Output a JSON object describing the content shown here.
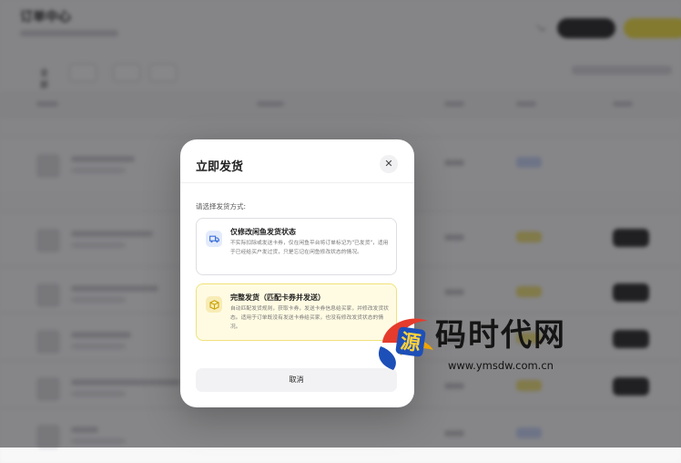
{
  "background": {
    "title": "订单中心",
    "active_tab": "全部"
  },
  "modal": {
    "title": "立即发货",
    "close_glyph": "✕",
    "prompt": "请选择发货方式:",
    "options": [
      {
        "title": "仅修改闲鱼发货状态",
        "desc": "不实际扣除或发送卡券，仅在闲鱼平台将订单标记为\"已发货\"，适用于已经给买户发过货，只是忘记在闲鱼修改状态的情况。",
        "icon": "truck-icon",
        "color": "#3b6fd8"
      },
      {
        "title": "完整发货（匹配卡券并发送）",
        "desc": "自动匹配发货规则，获取卡券，发送卡券信息给买家，并修改发货状态。适用于订单既没有发送卡券给买家，也没有修改发货状态的情况。",
        "icon": "box-icon",
        "color": "#c9a100"
      }
    ],
    "cancel_label": "取消"
  },
  "watermark": {
    "text": "码时代网",
    "url": "www.ymsdw.com.cn"
  },
  "colors": {
    "accent_yellow": "#f2e046",
    "dark_button": "#2a2a2a",
    "overlay": "rgba(20,20,24,0.50)"
  }
}
